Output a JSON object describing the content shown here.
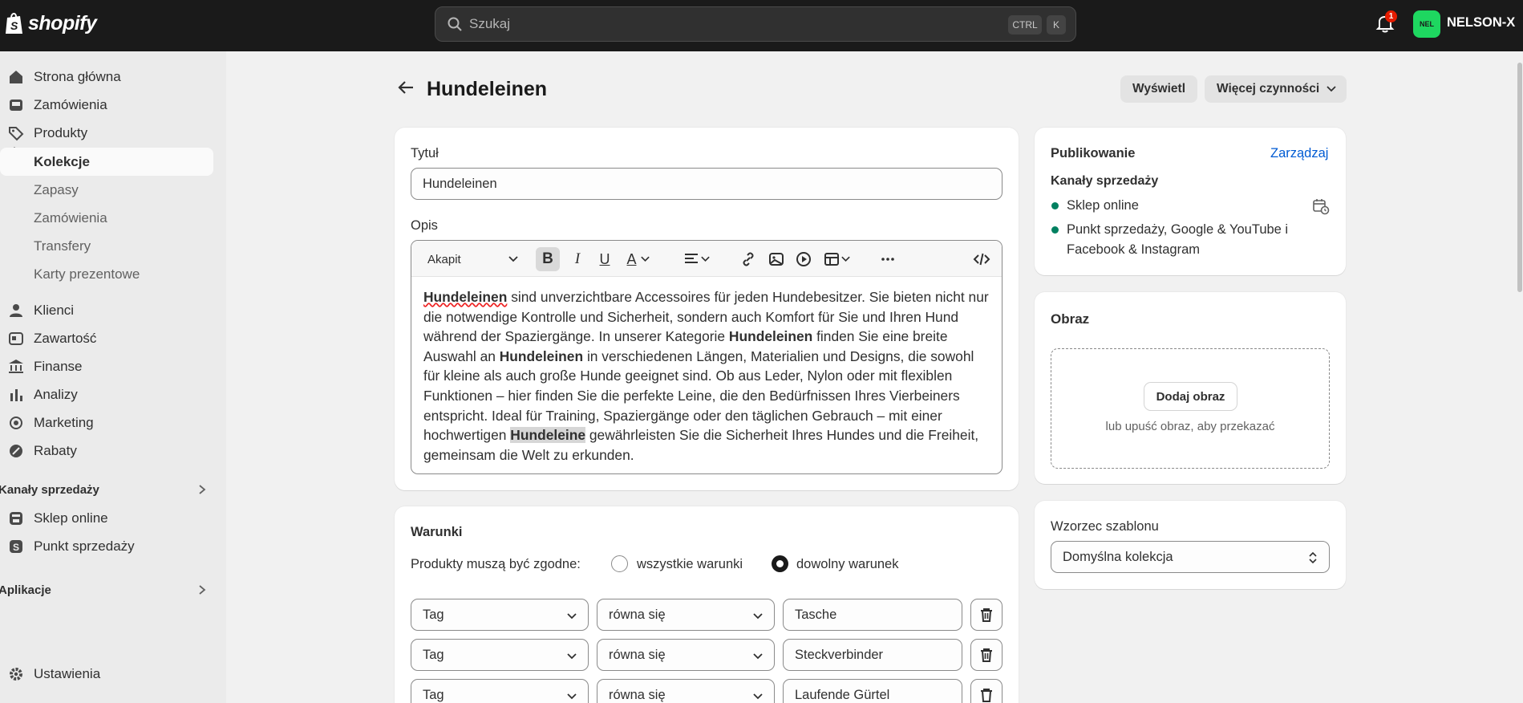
{
  "brand": "shopify",
  "search": {
    "placeholder": "Szukaj",
    "kbd1": "CTRL",
    "kbd2": "K"
  },
  "notifications": {
    "count": "1"
  },
  "account": {
    "initials": "NEL",
    "store": "NELSON-X"
  },
  "sidebar": {
    "items": [
      {
        "label": "Strona główna",
        "icon": "home-icon"
      },
      {
        "label": "Zamówienia",
        "icon": "inbox-icon"
      },
      {
        "label": "Produkty",
        "icon": "tag-icon"
      },
      {
        "label": "Kolekcje"
      },
      {
        "label": "Zapasy"
      },
      {
        "label": "Zamówienia"
      },
      {
        "label": "Transfery"
      },
      {
        "label": "Karty prezentowe"
      },
      {
        "label": "Klienci",
        "icon": "person-icon"
      },
      {
        "label": "Zawartość",
        "icon": "content-icon"
      },
      {
        "label": "Finanse",
        "icon": "bank-icon"
      },
      {
        "label": "Analizy",
        "icon": "chart-icon"
      },
      {
        "label": "Marketing",
        "icon": "target-icon"
      },
      {
        "label": "Rabaty",
        "icon": "discount-icon"
      }
    ],
    "sales_channels": "Kanały sprzedaży",
    "channels": [
      {
        "label": "Sklep online"
      },
      {
        "label": "Punkt sprzedaży"
      }
    ],
    "apps": "Aplikacje",
    "settings": "Ustawienia"
  },
  "page": {
    "title": "Hundeleinen",
    "view_button": "Wyświetl",
    "more_button": "Więcej czynności"
  },
  "form": {
    "title_label": "Tytuł",
    "title_value": "Hundeleinen",
    "desc_label": "Opis",
    "format": "Akapit",
    "description": {
      "p1": "Hundeleinen",
      "p2": " sind unverzichtbare Accessoires für jeden Hundebesitzer. Sie bieten nicht nur die notwendige Kontrolle und Sicherheit, sondern auch Komfort für Sie und Ihren Hund während der Spaziergänge. In unserer Kategorie ",
      "p3": "Hundeleinen",
      "p4": " finden Sie eine breite Auswahl an ",
      "p5": "Hundeleinen",
      "p6": " in verschiedenen Längen, Materialien und Designs, die sowohl für kleine als auch große Hunde geeignet sind. Ob aus Leder, Nylon oder mit flexiblen Funktionen – hier finden Sie die perfekte Leine, die den Bedürfnissen Ihres Vierbeiners entspricht. Ideal für Training, Spaziergänge oder den täglichen Gebrauch – mit einer hochwertigen ",
      "p7": "Hundeleine",
      "p8": " gewährleisten Sie die Sicherheit Ihres Hundes und die Freiheit, gemeinsam die Welt zu erkunden."
    }
  },
  "conditions": {
    "title": "Warunki",
    "match_label": "Produkty muszą być zgodne:",
    "opt_all": "wszystkie warunki",
    "opt_any": "dowolny warunek",
    "selected": "dowolny warunek",
    "rows": [
      {
        "field": "Tag",
        "op": "równa się",
        "value": "Tasche"
      },
      {
        "field": "Tag",
        "op": "równa się",
        "value": "Steckverbinder"
      },
      {
        "field": "Tag",
        "op": "równa się",
        "value": "Laufende Gürtel"
      }
    ]
  },
  "publishing": {
    "title": "Publikowanie",
    "manage": "Zarządzaj",
    "channels_label": "Kanały sprzedaży",
    "ch1": "Sklep online",
    "ch2a": "Punkt sprzedaży, Google & YouTube i",
    "ch2b": "Facebook & Instagram"
  },
  "image": {
    "title": "Obraz",
    "add": "Dodaj obraz",
    "hint": "lub upuść obraz, aby przekazać"
  },
  "template": {
    "title": "Wzorzec szablonu",
    "value": "Domyślna kolekcja"
  }
}
